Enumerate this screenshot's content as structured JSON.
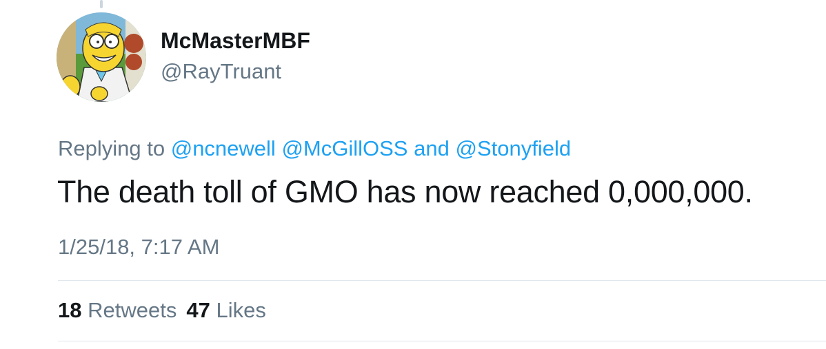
{
  "author": {
    "display_name": "McMasterMBF",
    "handle": "@RayTruant"
  },
  "reply": {
    "prefix": "Replying to",
    "mentions": [
      "@ncnewell",
      "@McGillOSS",
      "@Stonyfield"
    ],
    "conjunction": "and"
  },
  "tweet": {
    "text": "The death toll of GMO has now reached 0,000,000.",
    "timestamp": "1/25/18, 7:17 AM"
  },
  "stats": {
    "retweets_count": "18",
    "retweets_label": "Retweets",
    "likes_count": "47",
    "likes_label": "Likes"
  },
  "colors": {
    "link": "#1da1f2",
    "secondary_text": "#657786",
    "primary_text": "#14171a",
    "divider": "#e1e8ed"
  }
}
